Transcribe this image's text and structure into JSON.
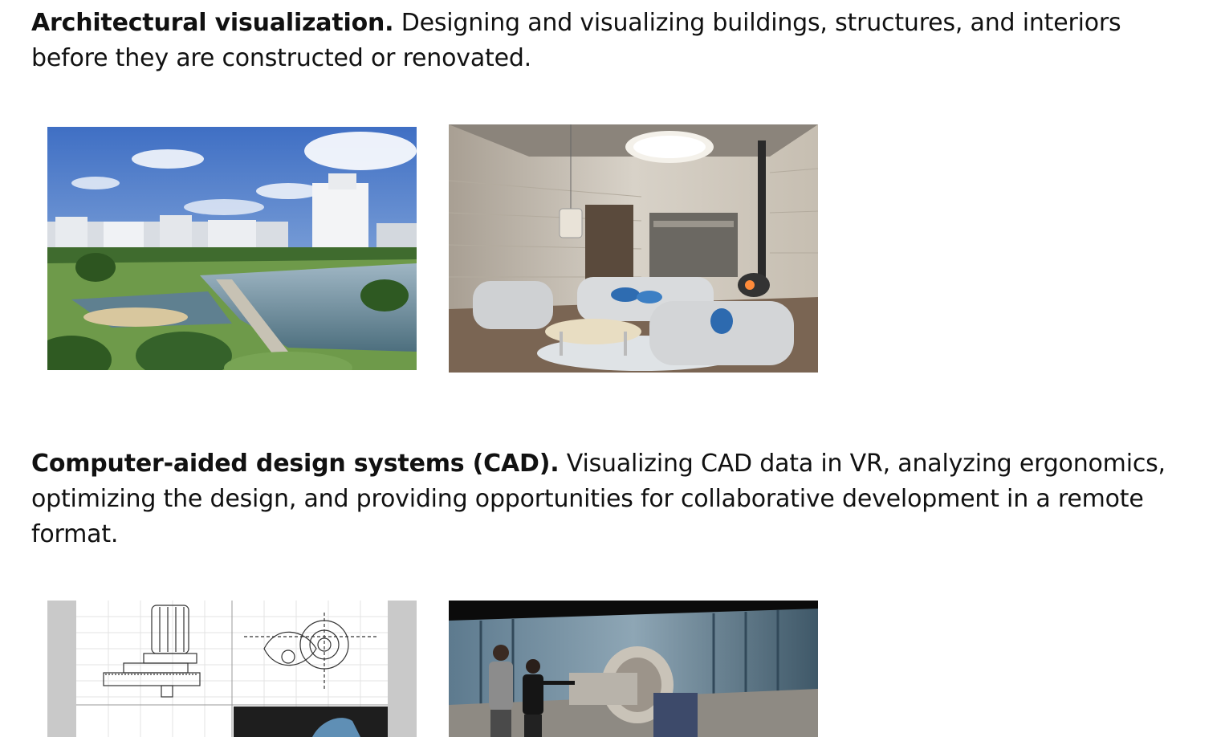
{
  "sections": [
    {
      "heading": "Architectural visualization.",
      "body": "Designing and visualizing buildings, structures, and interiors before they are constructed or renovated."
    },
    {
      "heading": "Computer-aided design systems (CAD).",
      "body": "Visualizing CAD data in VR, analyzing ergonomics, optimizing the design, and providing opportunities for collaborative development in a remote format."
    }
  ]
}
